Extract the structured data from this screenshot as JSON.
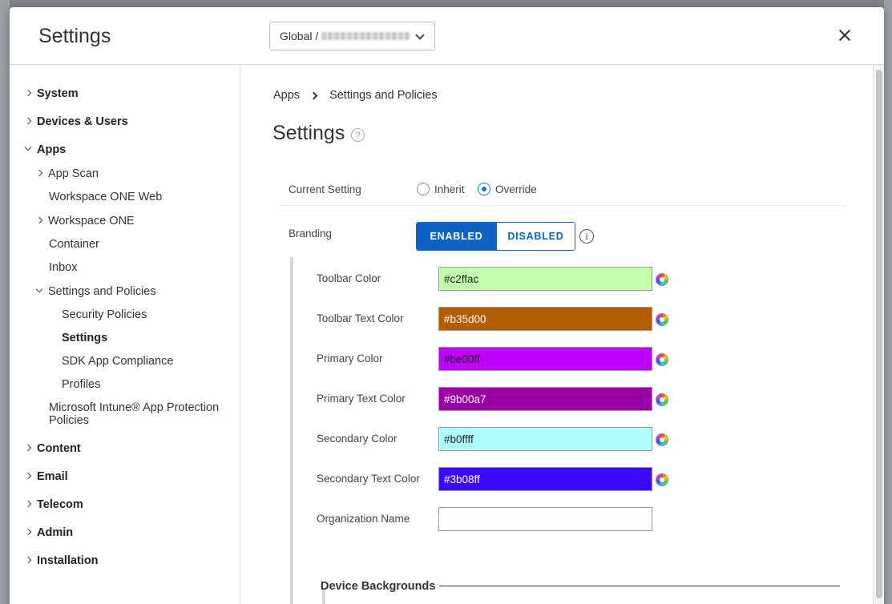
{
  "modal": {
    "title": "Settings",
    "scope_prefix": "Global /",
    "close_label": "×"
  },
  "sidebar": {
    "items": [
      {
        "label": "System"
      },
      {
        "label": "Devices & Users"
      },
      {
        "label": "Apps"
      },
      {
        "label": "App Scan"
      },
      {
        "label": "Workspace ONE Web"
      },
      {
        "label": "Workspace ONE"
      },
      {
        "label": "Container"
      },
      {
        "label": "Inbox"
      },
      {
        "label": "Settings and Policies"
      },
      {
        "label": "Security Policies"
      },
      {
        "label": "Settings"
      },
      {
        "label": "SDK App Compliance"
      },
      {
        "label": "Profiles"
      },
      {
        "label": "Microsoft Intune® App Protection"
      },
      {
        "label": "Policies"
      },
      {
        "label": "Content"
      },
      {
        "label": "Email"
      },
      {
        "label": "Telecom"
      },
      {
        "label": "Admin"
      },
      {
        "label": "Installation"
      }
    ]
  },
  "breadcrumb": {
    "root": "Apps",
    "current": "Settings and Policies"
  },
  "page": {
    "title": "Settings",
    "help": "?"
  },
  "current_setting": {
    "label": "Current Setting",
    "options": [
      "Inherit",
      "Override"
    ],
    "selected": "Override"
  },
  "branding": {
    "label": "Branding",
    "enabled_label": "ENABLED",
    "disabled_label": "DISABLED",
    "state": "ENABLED",
    "info": "i"
  },
  "colors": [
    {
      "label": "Toolbar Color",
      "value": "#c2ffac",
      "bg": "#c2ffac",
      "fg": "#222222"
    },
    {
      "label": "Toolbar Text Color",
      "value": "#b35d00",
      "bg": "#b35d00",
      "fg": "#ffffff"
    },
    {
      "label": "Primary Color",
      "value": "#be00ff",
      "bg": "#be00ff",
      "fg": "#222222"
    },
    {
      "label": "Primary Text Color",
      "value": "#9b00a7",
      "bg": "#9b00a7",
      "fg": "#ffffff"
    },
    {
      "label": "Secondary Color",
      "value": "#b0ffff",
      "bg": "#b0ffff",
      "fg": "#222222"
    },
    {
      "label": "Secondary Text Color",
      "value": "#3b08ff",
      "bg": "#3b08ff",
      "fg": "#ffffff"
    }
  ],
  "organization": {
    "label": "Organization Name",
    "value": ""
  },
  "device_backgrounds": {
    "title": "Device Backgrounds"
  }
}
